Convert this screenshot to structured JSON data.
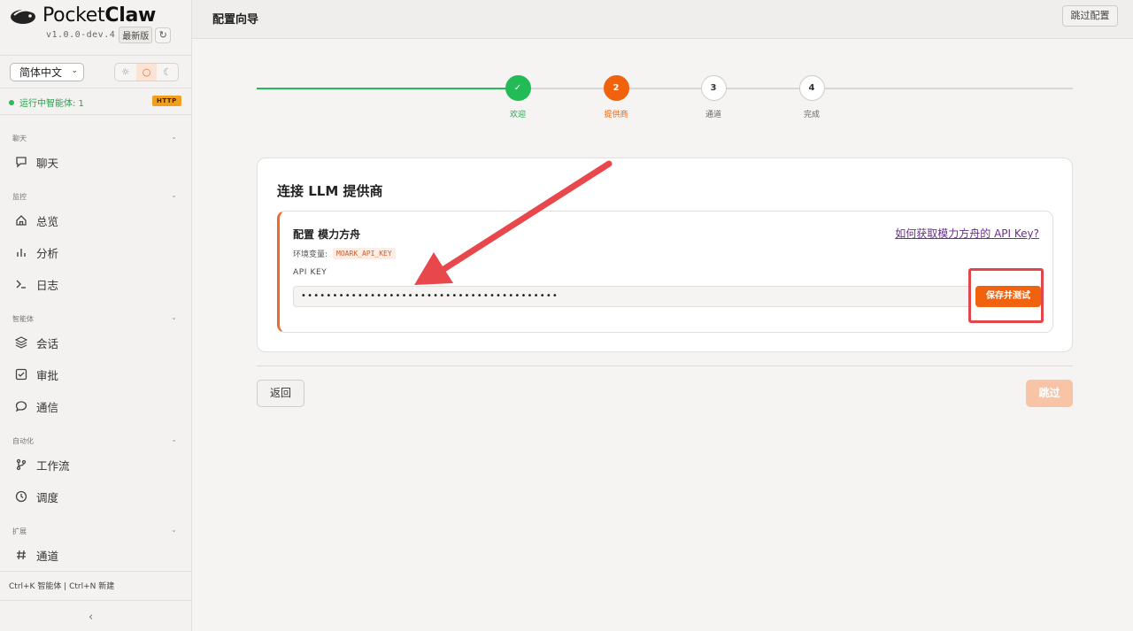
{
  "brand": {
    "name_light": "Pocket",
    "name_bold": "Claw",
    "version": "v1.0.0-dev.4",
    "latest_badge": "最新版",
    "refresh_glyph": "↻"
  },
  "sidebar": {
    "language": "简体中文",
    "theme_options": [
      {
        "icon": "sun-icon",
        "glyph": "☼"
      },
      {
        "icon": "auto-icon",
        "glyph": "○"
      },
      {
        "icon": "moon-icon",
        "glyph": "☾"
      }
    ],
    "active_theme_index": 1,
    "run_status": "运行中智能体: 1",
    "protocol_badge": "HTTP",
    "sections": [
      {
        "title": "聊天",
        "items": [
          {
            "label": "聊天",
            "icon": "chat-icon"
          }
        ]
      },
      {
        "title": "监控",
        "items": [
          {
            "label": "总览",
            "icon": "home-icon"
          },
          {
            "label": "分析",
            "icon": "bar-chart-icon"
          },
          {
            "label": "日志",
            "icon": "terminal-icon"
          }
        ]
      },
      {
        "title": "智能体",
        "items": [
          {
            "label": "会话",
            "icon": "layers-icon"
          },
          {
            "label": "审批",
            "icon": "checkbox-icon"
          },
          {
            "label": "通信",
            "icon": "message-icon"
          }
        ]
      },
      {
        "title": "自动化",
        "items": [
          {
            "label": "工作流",
            "icon": "branch-icon"
          },
          {
            "label": "调度",
            "icon": "clock-icon"
          }
        ]
      },
      {
        "title": "扩展",
        "items": [
          {
            "label": "通道",
            "icon": "hash-icon"
          }
        ]
      }
    ],
    "shortcuts": "Ctrl+K 智能体 | Ctrl+N 新建",
    "collapse_glyph": "‹"
  },
  "topbar": {
    "title": "配置向导",
    "skip_setup": "跳过配置"
  },
  "stepper": {
    "steps": [
      {
        "label": "欢迎",
        "marker": "✓",
        "state": "done"
      },
      {
        "label": "提供商",
        "marker": "2",
        "state": "active"
      },
      {
        "label": "通道",
        "marker": "3",
        "state": "pending"
      },
      {
        "label": "完成",
        "marker": "4",
        "state": "pending"
      }
    ]
  },
  "card": {
    "title": "连接 LLM 提供商",
    "provider_title": "配置 模力方舟",
    "help_link": "如何获取模力方舟的 API Key?",
    "env_label": "环境变量:",
    "env_var": "MOARK_API_KEY",
    "api_key_label": "API KEY",
    "api_key_value": "•••••••••••••••••••••••••••••••••••••••••",
    "save_test": "保存并测试"
  },
  "footer": {
    "back": "返回",
    "skip": "跳过"
  },
  "colors": {
    "accent": "#f0620e",
    "success": "#22bb55",
    "annotation": "#e0464b"
  }
}
